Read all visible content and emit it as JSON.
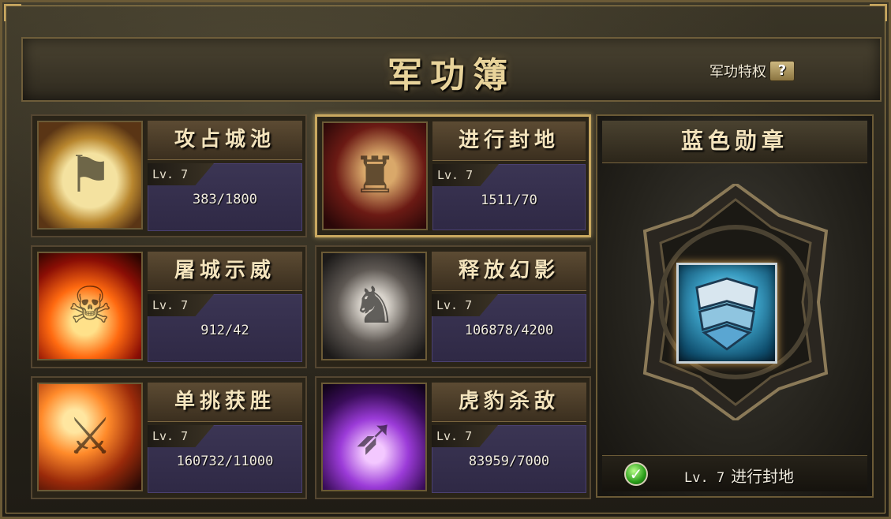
{
  "header": {
    "title": "军功簿",
    "privilege_label": "军功特权",
    "help_icon": "?"
  },
  "cards": [
    {
      "name": "攻占城池",
      "level": "Lv. 7",
      "progress": "383/1800",
      "icon": "scroll-flag-icon"
    },
    {
      "name": "进行封地",
      "level": "Lv. 7",
      "progress": "1511/70",
      "icon": "seal-icon",
      "selected": true
    },
    {
      "name": "屠城示威",
      "level": "Lv. 7",
      "progress": "912/42",
      "icon": "flame-warrior-icon"
    },
    {
      "name": "释放幻影",
      "level": "Lv. 7",
      "progress": "106878/4200",
      "icon": "phantom-horse-icon"
    },
    {
      "name": "单挑获胜",
      "level": "Lv. 7",
      "progress": "160732/11000",
      "icon": "duel-warrior-icon"
    },
    {
      "name": "虎豹杀敌",
      "level": "Lv. 7",
      "progress": "83959/7000",
      "icon": "spears-icon"
    }
  ],
  "medal": {
    "title": "蓝色勋章",
    "footer_level": "Lv. 7",
    "footer_label": "进行封地",
    "check_icon": "check-icon",
    "badge_icon": "blue-medal-icon"
  }
}
